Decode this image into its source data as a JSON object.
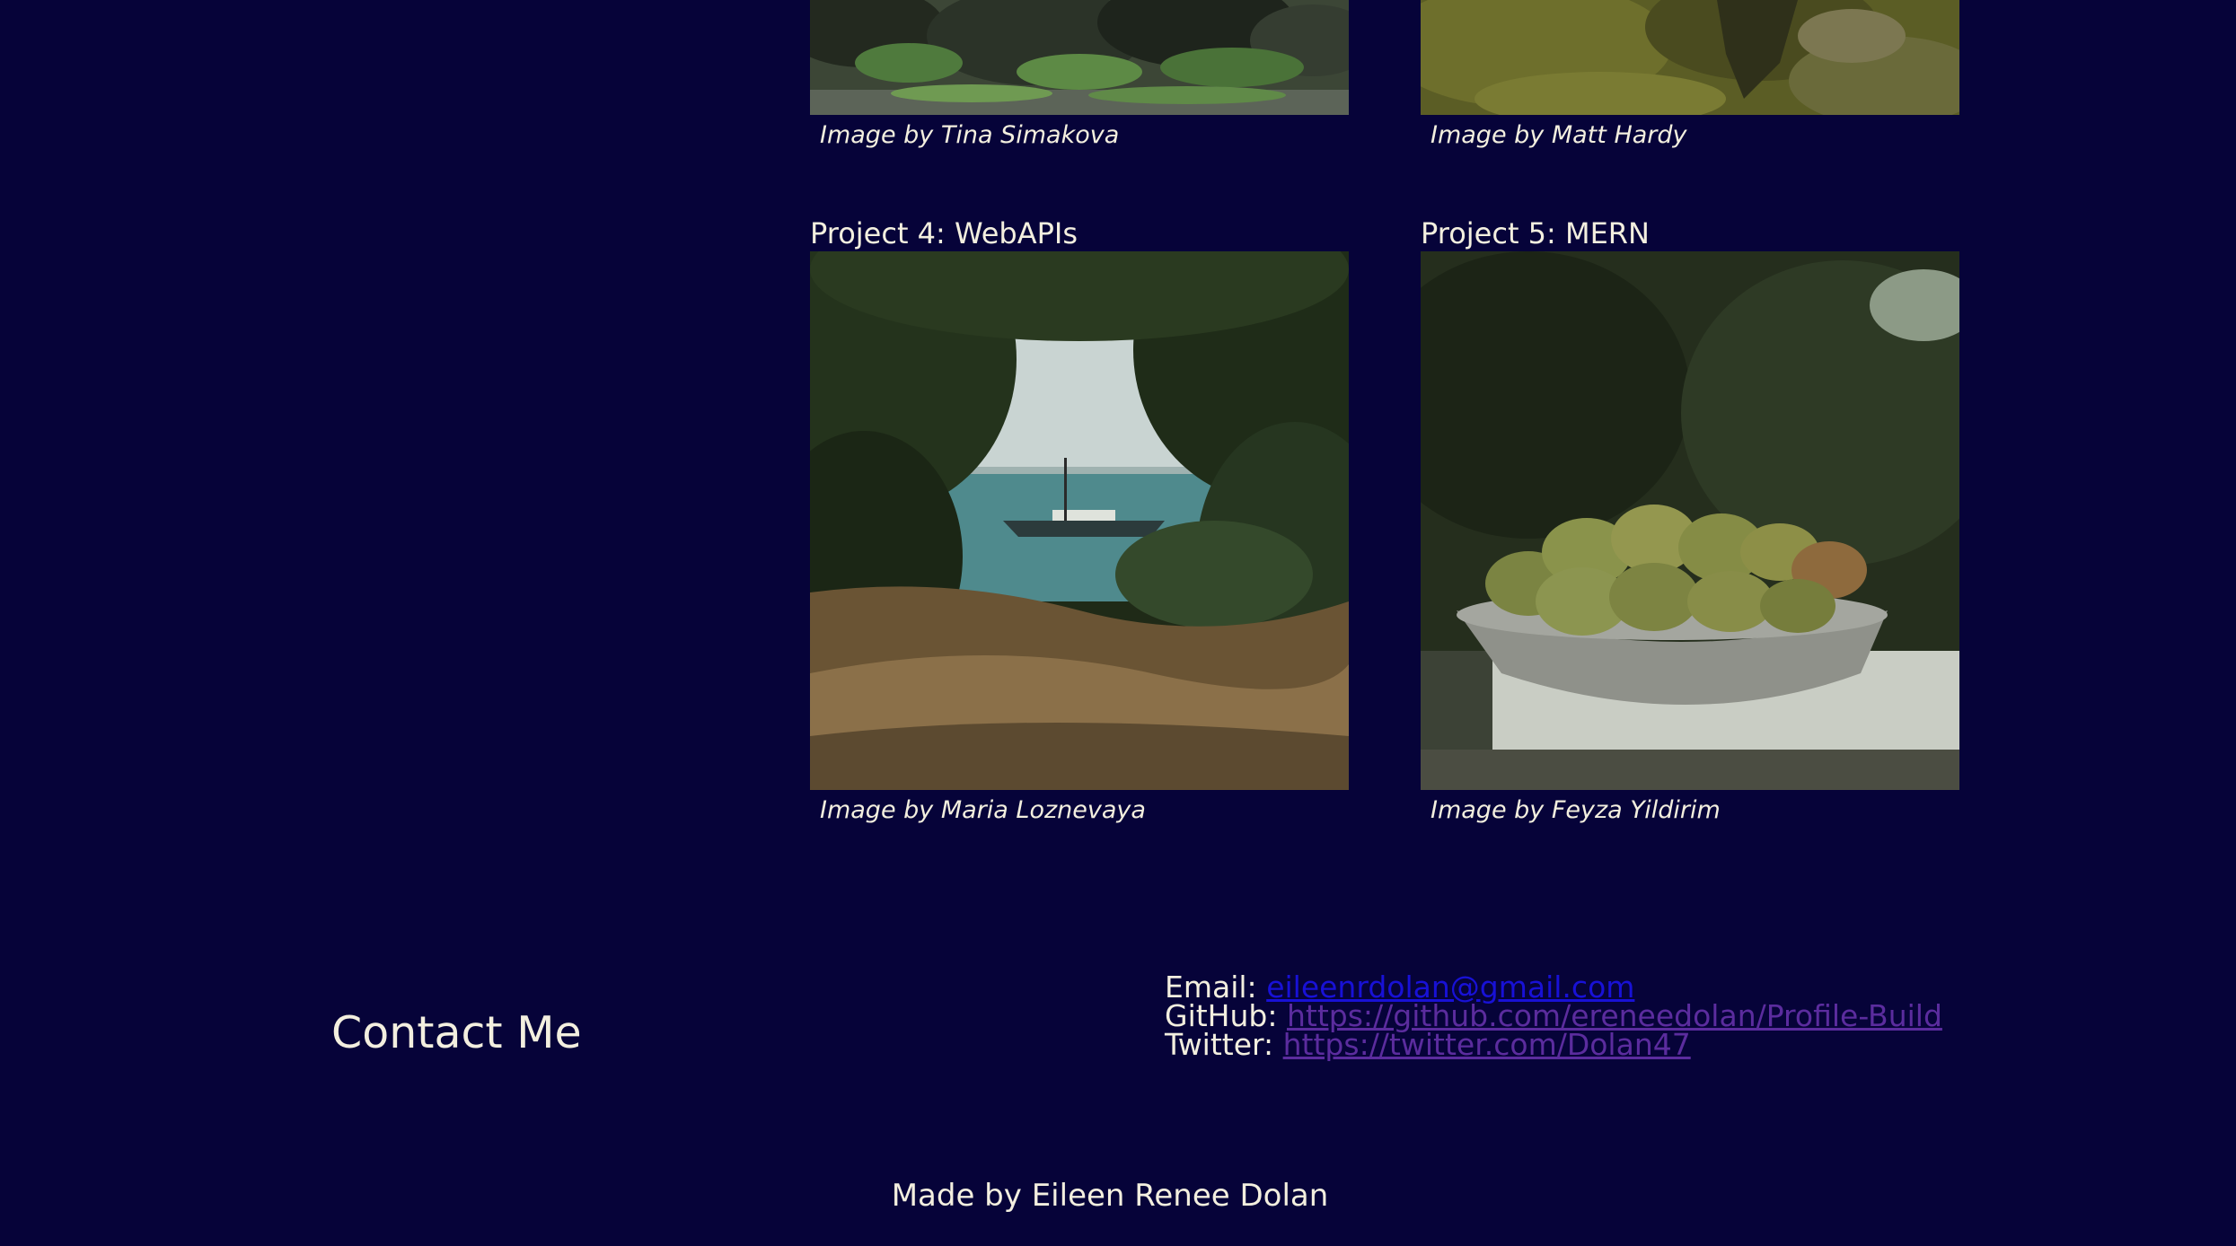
{
  "projects_top": [
    {
      "caption": "Image by Tina Simakova",
      "image": "rocky-ground-with-plants-photo"
    },
    {
      "caption": "Image by Matt Hardy",
      "image": "mossy-rocks-photo"
    }
  ],
  "projects": [
    {
      "title": "Project 4: WebAPIs",
      "caption": "Image by Maria Loznevaya",
      "image": "boat-framed-by-trees-photo"
    },
    {
      "title": "Project 5: MERN",
      "caption": "Image by Feyza Yildirim",
      "image": "bowl-of-pears-photo"
    }
  ],
  "contact": {
    "heading": "Contact Me",
    "email_label": "Email:",
    "email_value": "eileenrdolan@gmail.com",
    "github_label": "GitHub:",
    "github_value": "https://github.com/ereneedolan/Profile-Build",
    "twitter_label": "Twitter:",
    "twitter_value": "https://twitter.com/Dolan47"
  },
  "footer": {
    "text": "Made by Eileen Renee Dolan"
  },
  "colors": {
    "background": "#060339",
    "text": "#f3efdf",
    "link": "#1811d6",
    "visited_link": "#5b2c9e"
  }
}
